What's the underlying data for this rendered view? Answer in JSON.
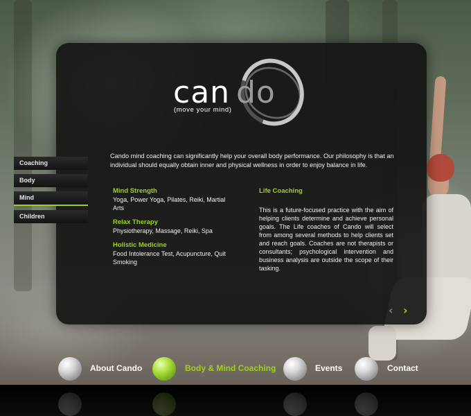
{
  "logo": {
    "word_left": "can",
    "word_right": "do",
    "tagline": "(move your mind)"
  },
  "intro": "Cando mind coaching can significantly help your overall body performance. Our philosophy is that an individual should equally obtain inner and physical wellness in order to enjoy balance in life.",
  "sidebar": {
    "items": [
      {
        "label": "Coaching"
      },
      {
        "label": "Body"
      },
      {
        "label": "Mind"
      },
      {
        "label": "Children"
      }
    ]
  },
  "left_sections": [
    {
      "title": "Mind Strength",
      "body": "Yoga, Power Yoga, Pilates, Reiki, Martial Arts"
    },
    {
      "title": "Relax Therapy",
      "body": "Physiotherapy, Massage, Reiki, Spa"
    },
    {
      "title": "Holistic Medicine",
      "body": "Food Intolerance Test, Acupuncture, Quit Smoking"
    }
  ],
  "right_section": {
    "title": "Life Coaching",
    "body": "This is a future-focused practice with the aim of helping clients determine and achieve personal goals. The Life coaches of Cando will select from among several methods to help clients set and reach goals. Coaches are not therapists or consultants; psychological intervention and business analysis are outside the scope of their tasking."
  },
  "pager": {
    "prev": "‹",
    "next": "›"
  },
  "bottom_nav": [
    {
      "label": "About Cando"
    },
    {
      "label": "Body & Mind Coaching"
    },
    {
      "label": "Events"
    },
    {
      "label": "Contact"
    }
  ],
  "colors": {
    "accent": "#9ed21c",
    "panel": "#121212",
    "text": "#f0f0f0"
  }
}
